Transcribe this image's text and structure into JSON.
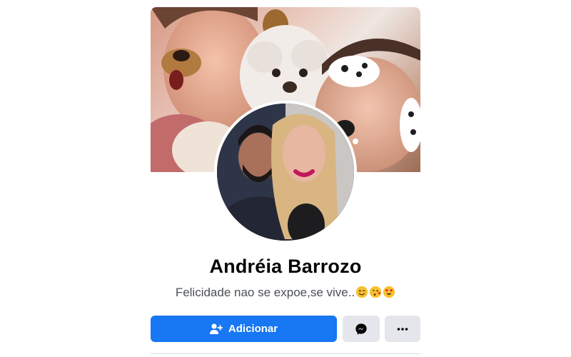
{
  "profile": {
    "name": "Andréia Barrozo",
    "bio": "Felicidade nao se expoe,se vive.."
  },
  "bio_emojis": [
    "winking-face",
    "face-blowing-kiss",
    "heart-eyes-face"
  ],
  "actions": {
    "add_label": "Adicionar",
    "add_icon": "add-friend-icon",
    "message_icon": "messenger-icon",
    "more_icon": "more-dots-icon"
  },
  "colors": {
    "primary": "#1877f2",
    "secondary_button": "#e4e6eb",
    "name_text": "#050505",
    "bio_text": "#4b4f56"
  }
}
